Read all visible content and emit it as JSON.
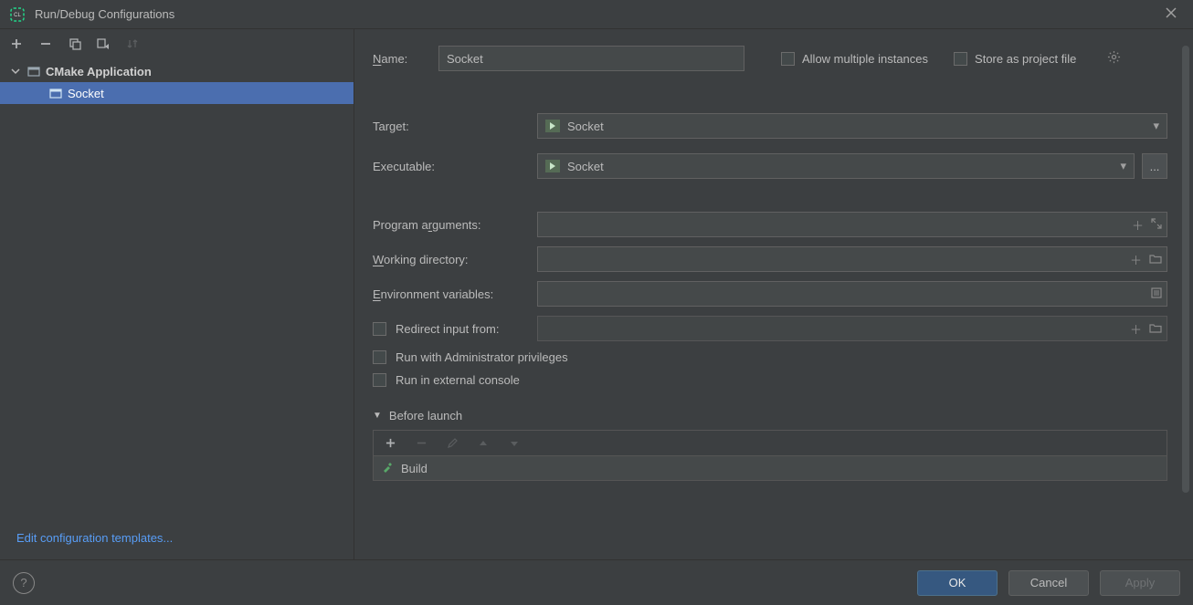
{
  "window": {
    "title": "Run/Debug Configurations"
  },
  "left": {
    "group_label": "CMake Application",
    "items": [
      {
        "label": "Socket"
      }
    ],
    "edit_templates": "Edit configuration templates..."
  },
  "form": {
    "name_label": "Name:",
    "name_value": "Socket",
    "allow_multi": "Allow multiple instances",
    "store_project": "Store as project file",
    "target_label": "Target:",
    "target_value": "Socket",
    "executable_label": "Executable:",
    "executable_value": "Socket",
    "program_args_label": "Program arguments:",
    "program_args_value": "",
    "working_dir_label": "Working directory:",
    "working_dir_value": "",
    "env_label": "Environment variables:",
    "env_value": "",
    "redirect_label": "Redirect input from:",
    "redirect_value": "",
    "admin_label": "Run with Administrator privileges",
    "ext_console_label": "Run in external console",
    "before_launch_label": "Before launch",
    "build_label": "Build"
  },
  "buttons": {
    "ok": "OK",
    "cancel": "Cancel",
    "apply": "Apply"
  }
}
